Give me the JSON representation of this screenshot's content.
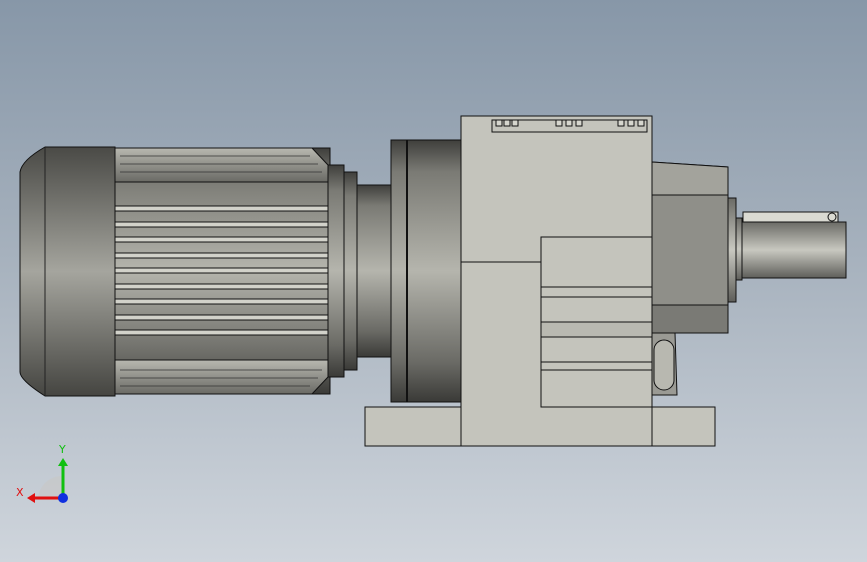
{
  "viewport": {
    "background_top": "#8797a8",
    "background_bottom": "#cfd5dc"
  },
  "model": {
    "icon": "gearmotor-model",
    "body_color": "#c4c4bc",
    "edge_color": "#111111",
    "motor_color": "#8e8e88"
  },
  "triad": {
    "x_label": "X",
    "y_label": "Y",
    "x_color": "#e01010",
    "y_color": "#10c010",
    "z_color": "#1030e0"
  }
}
